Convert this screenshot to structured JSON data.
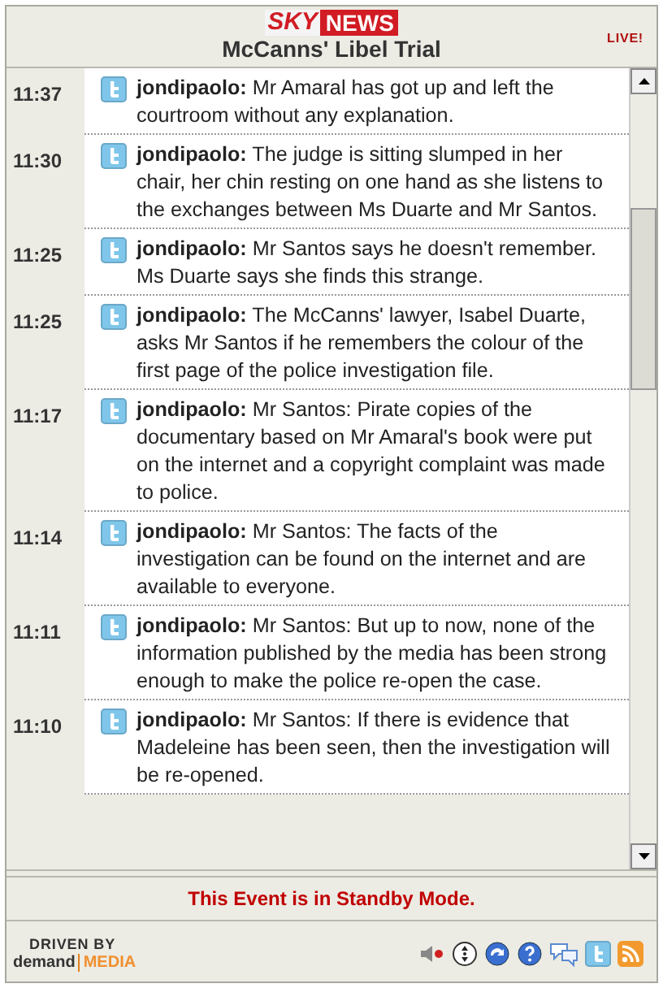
{
  "header": {
    "logo_left": "SKY",
    "logo_right": "NEWS",
    "title": "McCanns' Libel Trial",
    "live_badge": "LIVE!"
  },
  "feed": [
    {
      "time": "11:37",
      "message": "**jondipaolo:** Mr Amaral has got up and left the courtroom without any explanation."
    },
    {
      "time": "11:30",
      "message": "**jondipaolo:** The judge is sitting slumped in her chair, her chin resting on one hand as she listens to the exchanges between Ms Duarte and Mr Santos."
    },
    {
      "time": "11:25",
      "message": "**jondipaolo:** Mr Santos says he doesn't remember. Ms Duarte says she finds this strange."
    },
    {
      "time": "11:25",
      "message": "**jondipaolo:** The McCanns' lawyer, Isabel Duarte, asks Mr Santos if he remembers the colour of the first page of the police investigation file."
    },
    {
      "time": "11:17",
      "message": "**jondipaolo:** Mr Santos: Pirate copies of the documentary based on Mr Amaral's book were put on the internet and a copyright complaint was made to police."
    },
    {
      "time": "11:14",
      "message": "**jondipaolo:** Mr Santos: The facts of the investigation can be found on the internet and are available to everyone."
    },
    {
      "time": "11:11",
      "message": "**jondipaolo:** Mr Santos: But up to now, none of the information published by the media has been strong enough to make the police re-open the case."
    },
    {
      "time": "11:10",
      "message": "**jondipaolo:** Mr Santos: If there is evidence that Madeleine has been seen, then the investigation will be re-opened."
    }
  ],
  "status": "This Event is in Standby Mode.",
  "footer": {
    "brand_top": "DRIVEN BY",
    "brand_left": "demand",
    "brand_right": "MEDIA"
  }
}
